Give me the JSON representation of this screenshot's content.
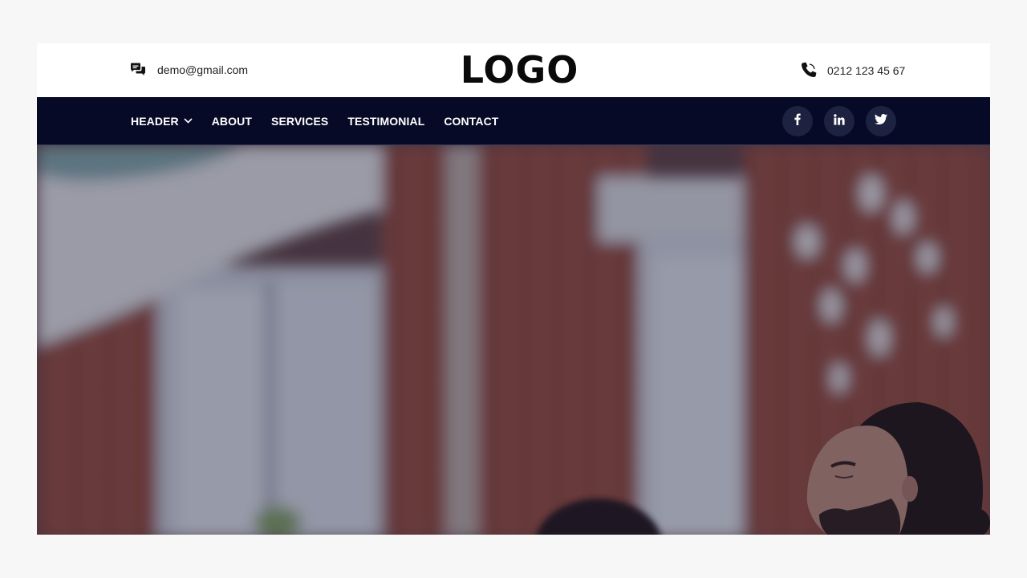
{
  "header": {
    "email": "demo@gmail.com",
    "logo_text": "LOGO",
    "phone": "0212 123 45 67",
    "icons": {
      "email": "chat-bubbles-icon",
      "phone": "phone-icon"
    }
  },
  "nav": {
    "items": [
      {
        "label": "HEADER",
        "has_dropdown": true
      },
      {
        "label": "ABOUT"
      },
      {
        "label": "SERVICES"
      },
      {
        "label": "TESTIMONIAL"
      },
      {
        "label": "CONTACT"
      }
    ],
    "dropdown_icon": "chevron-down-icon"
  },
  "socials": [
    {
      "icon": "facebook-icon"
    },
    {
      "icon": "linkedin-icon"
    },
    {
      "icon": "twitter-icon"
    }
  ],
  "colors": {
    "navbar_bg": "#070a26",
    "social_bg": "#1d2240",
    "page_bg": "#f7f7f7",
    "text_dark": "#222222"
  }
}
